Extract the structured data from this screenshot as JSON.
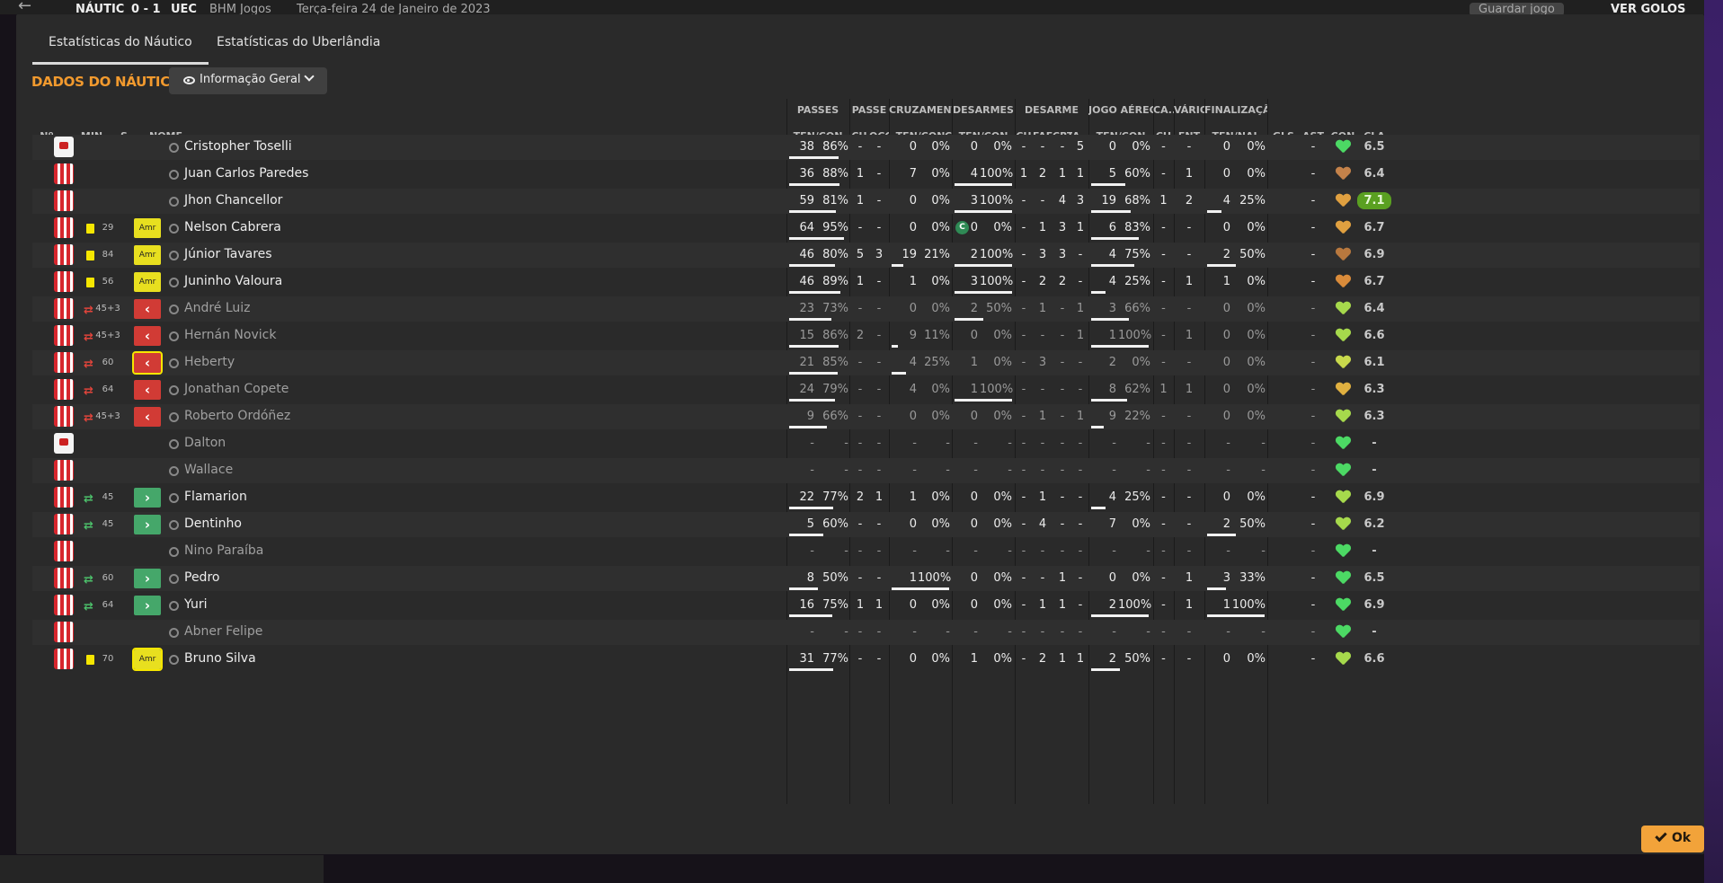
{
  "background": {
    "match_title": "NÁUTIC",
    "score": "0 - 1",
    "opponent": "UEC",
    "competition": "BHM Jogos",
    "date": "Terça-feira 24 de Janeiro de 2023",
    "save_label": "Guardar jogo",
    "goals_label": "VER GOLOS"
  },
  "tabs": [
    {
      "label": "Estatísticas do Náutico",
      "active": true
    },
    {
      "label": "Estatísticas do Uberlândia",
      "active": false
    }
  ],
  "team_title": "DADOS DO NÁUTICO",
  "view_selector": {
    "label": "Informação Geral"
  },
  "groups": [
    "PASSES",
    "PASSE",
    "CRUZAMENTOS",
    "DESARMES",
    "DESARME",
    "JOGO AÉREO",
    "CA...",
    "VÁRIOS",
    "FINALIZAÇÃO"
  ],
  "columns": {
    "num": "Nº",
    "min": "MIN",
    "s": "S",
    "name": "NOME",
    "c": "C",
    "passes": "TEN/CON",
    "passe_ch": "CH",
    "passe_ocg": "OCG",
    "cruz": "TEN/CON",
    "des": "TEN/CON",
    "desarme_ch": "CH",
    "desarme_faf": "FAF",
    "desarme_crt": "CRT",
    "desarme_a": "A...",
    "aereo": "TEN/CON",
    "ca_ch": "CH",
    "varios_fnt": "FNT",
    "fin": "TEN/NAL",
    "gls": "GLS",
    "ast": "AST",
    "con": "CON",
    "cla": "CLA"
  },
  "players": [
    {
      "name": "Cristopher Toselli",
      "gk": true,
      "card": false,
      "sub": "",
      "min": "",
      "badge": "",
      "captain": false,
      "dim": false,
      "passes": [
        "38",
        "86%"
      ],
      "passes_frac": 0.86,
      "passe": [
        "-",
        "-"
      ],
      "cruz": [
        "0",
        "0%"
      ],
      "cruz_frac": 0,
      "des": [
        "0",
        "0%"
      ],
      "des_frac": 0,
      "desarme": [
        "-",
        "-",
        "-",
        "5"
      ],
      "aereo": [
        "0",
        "0%"
      ],
      "aereo_frac": 0,
      "ca": "-",
      "fnt": "-",
      "fin": [
        "0",
        "0%"
      ],
      "fin_frac": 0,
      "ast": "-",
      "con_color": "#4cd964",
      "rating": "6.5",
      "best": false
    },
    {
      "name": "Juan Carlos Paredes",
      "gk": false,
      "card": false,
      "sub": "",
      "min": "",
      "badge": "",
      "captain": false,
      "dim": false,
      "passes": [
        "36",
        "88%"
      ],
      "passes_frac": 0.88,
      "passe": [
        "1",
        "-"
      ],
      "cruz": [
        "7",
        "0%"
      ],
      "cruz_frac": 0,
      "des": [
        "4",
        "100%"
      ],
      "des_frac": 1,
      "desarme": [
        "1",
        "2",
        "1",
        "1"
      ],
      "aereo": [
        "5",
        "60%"
      ],
      "aereo_frac": 0.6,
      "ca": "-",
      "fnt": "1",
      "fin": [
        "0",
        "0%"
      ],
      "fin_frac": 0,
      "ast": "-",
      "con_color": "#c4824a",
      "rating": "6.4",
      "best": false
    },
    {
      "name": "Jhon Chancellor",
      "gk": false,
      "card": false,
      "sub": "",
      "min": "",
      "badge": "",
      "captain": false,
      "dim": false,
      "passes": [
        "59",
        "81%"
      ],
      "passes_frac": 0.81,
      "passe": [
        "1",
        "-"
      ],
      "cruz": [
        "0",
        "0%"
      ],
      "cruz_frac": 0,
      "des": [
        "3",
        "100%"
      ],
      "des_frac": 1,
      "desarme": [
        "-",
        "-",
        "4",
        "3"
      ],
      "aereo": [
        "19",
        "68%"
      ],
      "aereo_frac": 0.68,
      "ca": "1",
      "fnt": "2",
      "fin": [
        "4",
        "25%"
      ],
      "fin_frac": 0.25,
      "ast": "-",
      "con_color": "#e0a040",
      "rating": "7.1",
      "best": true
    },
    {
      "name": "Nelson Cabrera",
      "gk": false,
      "card": true,
      "sub": "",
      "min": "29",
      "badge": "Amr",
      "captain": true,
      "dim": false,
      "passes": [
        "64",
        "95%"
      ],
      "passes_frac": 0.95,
      "passe": [
        "-",
        "-"
      ],
      "cruz": [
        "0",
        "0%"
      ],
      "cruz_frac": 0,
      "des": [
        "0",
        "0%"
      ],
      "des_frac": 0,
      "desarme": [
        "-",
        "1",
        "3",
        "1"
      ],
      "aereo": [
        "6",
        "83%"
      ],
      "aereo_frac": 0.83,
      "ca": "-",
      "fnt": "-",
      "fin": [
        "0",
        "0%"
      ],
      "fin_frac": 0,
      "ast": "-",
      "con_color": "#e0a040",
      "rating": "6.7",
      "best": false
    },
    {
      "name": "Júnior Tavares",
      "gk": false,
      "card": true,
      "sub": "",
      "min": "84",
      "badge": "Amr",
      "captain": false,
      "dim": false,
      "passes": [
        "46",
        "80%"
      ],
      "passes_frac": 0.8,
      "passe": [
        "5",
        "3"
      ],
      "cruz": [
        "19",
        "21%"
      ],
      "cruz_frac": 0.21,
      "des": [
        "2",
        "100%"
      ],
      "des_frac": 1,
      "desarme": [
        "-",
        "3",
        "3",
        "-"
      ],
      "aereo": [
        "4",
        "75%"
      ],
      "aereo_frac": 0.75,
      "ca": "-",
      "fnt": "-",
      "fin": [
        "2",
        "50%"
      ],
      "fin_frac": 0.5,
      "ast": "-",
      "con_color": "#b8783e",
      "rating": "6.9",
      "best": false
    },
    {
      "name": "Juninho Valoura",
      "gk": false,
      "card": true,
      "sub": "",
      "min": "56",
      "badge": "Amr",
      "captain": false,
      "dim": false,
      "passes": [
        "46",
        "89%"
      ],
      "passes_frac": 0.89,
      "passe": [
        "1",
        "-"
      ],
      "cruz": [
        "1",
        "0%"
      ],
      "cruz_frac": 0,
      "des": [
        "3",
        "100%"
      ],
      "des_frac": 1,
      "desarme": [
        "-",
        "2",
        "2",
        "-"
      ],
      "aereo": [
        "4",
        "25%"
      ],
      "aereo_frac": 0.25,
      "ca": "-",
      "fnt": "1",
      "fin": [
        "1",
        "0%"
      ],
      "fin_frac": 0,
      "ast": "-",
      "con_color": "#d98b3a",
      "rating": "6.7",
      "best": false
    },
    {
      "name": "André Luiz",
      "gk": false,
      "card": false,
      "sub": "out",
      "min": "45+3",
      "badge": "out",
      "captain": false,
      "dim": true,
      "passes": [
        "23",
        "73%"
      ],
      "passes_frac": 0.73,
      "passe": [
        "-",
        "-"
      ],
      "cruz": [
        "0",
        "0%"
      ],
      "cruz_frac": 0,
      "des": [
        "2",
        "50%"
      ],
      "des_frac": 0.5,
      "desarme": [
        "-",
        "1",
        "-",
        "1"
      ],
      "aereo": [
        "3",
        "66%"
      ],
      "aereo_frac": 0.66,
      "ca": "-",
      "fnt": "-",
      "fin": [
        "0",
        "0%"
      ],
      "fin_frac": 0,
      "ast": "-",
      "con_color": "#a6d94c",
      "rating": "6.4",
      "best": false
    },
    {
      "name": "Hernán Novick",
      "gk": false,
      "card": false,
      "sub": "out",
      "min": "45+3",
      "badge": "out",
      "captain": false,
      "dim": true,
      "passes": [
        "15",
        "86%"
      ],
      "passes_frac": 0.86,
      "passe": [
        "2",
        "-"
      ],
      "cruz": [
        "9",
        "11%"
      ],
      "cruz_frac": 0.11,
      "des": [
        "0",
        "0%"
      ],
      "des_frac": 0,
      "desarme": [
        "-",
        "-",
        "-",
        "1"
      ],
      "aereo": [
        "1",
        "100%"
      ],
      "aereo_frac": 1,
      "ca": "-",
      "fnt": "1",
      "fin": [
        "0",
        "0%"
      ],
      "fin_frac": 0,
      "ast": "-",
      "con_color": "#a6d94c",
      "rating": "6.6",
      "best": false
    },
    {
      "name": "Heberty",
      "gk": false,
      "card": false,
      "sub": "out",
      "min": "60",
      "badge": "out",
      "badge_sel": true,
      "captain": false,
      "dim": true,
      "passes": [
        "21",
        "85%"
      ],
      "passes_frac": 0.85,
      "passe": [
        "-",
        "-"
      ],
      "cruz": [
        "4",
        "25%"
      ],
      "cruz_frac": 0.25,
      "des": [
        "1",
        "0%"
      ],
      "des_frac": 0,
      "desarme": [
        "-",
        "3",
        "-",
        "-"
      ],
      "aereo": [
        "2",
        "0%"
      ],
      "aereo_frac": 0,
      "ca": "-",
      "fnt": "-",
      "fin": [
        "0",
        "0%"
      ],
      "fin_frac": 0,
      "ast": "-",
      "con_color": "#c8d94c",
      "rating": "6.1",
      "best": false
    },
    {
      "name": "Jonathan Copete",
      "gk": false,
      "card": false,
      "sub": "out",
      "min": "64",
      "badge": "out",
      "captain": false,
      "dim": true,
      "passes": [
        "24",
        "79%"
      ],
      "passes_frac": 0.79,
      "passe": [
        "-",
        "-"
      ],
      "cruz": [
        "4",
        "0%"
      ],
      "cruz_frac": 0,
      "des": [
        "1",
        "100%"
      ],
      "des_frac": 1,
      "desarme": [
        "-",
        "-",
        "-",
        "-"
      ],
      "aereo": [
        "8",
        "62%"
      ],
      "aereo_frac": 0.62,
      "ca": "1",
      "fnt": "1",
      "fin": [
        "0",
        "0%"
      ],
      "fin_frac": 0,
      "ast": "-",
      "con_color": "#e0b040",
      "rating": "6.3",
      "best": false
    },
    {
      "name": "Roberto Ordóñez",
      "gk": false,
      "card": false,
      "sub": "out",
      "min": "45+3",
      "badge": "out",
      "captain": false,
      "dim": true,
      "passes": [
        "9",
        "66%"
      ],
      "passes_frac": 0.66,
      "passe": [
        "-",
        "-"
      ],
      "cruz": [
        "0",
        "0%"
      ],
      "cruz_frac": 0,
      "des": [
        "0",
        "0%"
      ],
      "des_frac": 0,
      "desarme": [
        "-",
        "1",
        "-",
        "1"
      ],
      "aereo": [
        "9",
        "22%"
      ],
      "aereo_frac": 0.22,
      "ca": "-",
      "fnt": "-",
      "fin": [
        "0",
        "0%"
      ],
      "fin_frac": 0,
      "ast": "-",
      "con_color": "#a6d94c",
      "rating": "6.3",
      "best": false
    },
    {
      "name": "Dalton",
      "gk": true,
      "card": false,
      "sub": "",
      "min": "",
      "badge": "",
      "captain": false,
      "dim": true,
      "passes": [
        "-",
        "-"
      ],
      "passes_frac": 0,
      "passe": [
        "-",
        "-"
      ],
      "cruz": [
        "-",
        "-"
      ],
      "cruz_frac": 0,
      "des": [
        "-",
        "-"
      ],
      "des_frac": 0,
      "desarme": [
        "-",
        "-",
        "-",
        "-"
      ],
      "aereo": [
        "-",
        "-"
      ],
      "aereo_frac": 0,
      "ca": "-",
      "fnt": "-",
      "fin": [
        "-",
        "-"
      ],
      "fin_frac": 0,
      "ast": "-",
      "con_color": "#4cd964",
      "rating": "-",
      "best": false
    },
    {
      "name": "Wallace",
      "gk": false,
      "card": false,
      "sub": "",
      "min": "",
      "badge": "",
      "captain": false,
      "dim": true,
      "passes": [
        "-",
        "-"
      ],
      "passes_frac": 0,
      "passe": [
        "-",
        "-"
      ],
      "cruz": [
        "-",
        "-"
      ],
      "cruz_frac": 0,
      "des": [
        "-",
        "-"
      ],
      "des_frac": 0,
      "desarme": [
        "-",
        "-",
        "-",
        "-"
      ],
      "aereo": [
        "-",
        "-"
      ],
      "aereo_frac": 0,
      "ca": "-",
      "fnt": "-",
      "fin": [
        "-",
        "-"
      ],
      "fin_frac": 0,
      "ast": "-",
      "con_color": "#4cd964",
      "rating": "-",
      "best": false
    },
    {
      "name": "Flamarion",
      "gk": false,
      "card": false,
      "sub": "in",
      "min": "45",
      "badge": "in",
      "captain": false,
      "dim": false,
      "passes": [
        "22",
        "77%"
      ],
      "passes_frac": 0.77,
      "passe": [
        "2",
        "1"
      ],
      "cruz": [
        "1",
        "0%"
      ],
      "cruz_frac": 0,
      "des": [
        "0",
        "0%"
      ],
      "des_frac": 0,
      "desarme": [
        "-",
        "1",
        "-",
        "-"
      ],
      "aereo": [
        "4",
        "25%"
      ],
      "aereo_frac": 0.25,
      "ca": "-",
      "fnt": "-",
      "fin": [
        "0",
        "0%"
      ],
      "fin_frac": 0,
      "ast": "-",
      "con_color": "#a6d94c",
      "rating": "6.9",
      "best": false
    },
    {
      "name": "Dentinho",
      "gk": false,
      "card": false,
      "sub": "in",
      "min": "45",
      "badge": "in",
      "captain": false,
      "dim": false,
      "passes": [
        "5",
        "60%"
      ],
      "passes_frac": 0.6,
      "passe": [
        "-",
        "-"
      ],
      "cruz": [
        "0",
        "0%"
      ],
      "cruz_frac": 0,
      "des": [
        "0",
        "0%"
      ],
      "des_frac": 0,
      "desarme": [
        "-",
        "4",
        "-",
        "-"
      ],
      "aereo": [
        "7",
        "0%"
      ],
      "aereo_frac": 0,
      "ca": "-",
      "fnt": "-",
      "fin": [
        "2",
        "50%"
      ],
      "fin_frac": 0.5,
      "ast": "-",
      "con_color": "#a6d94c",
      "rating": "6.2",
      "best": false
    },
    {
      "name": "Nino Paraíba",
      "gk": false,
      "card": false,
      "sub": "",
      "min": "",
      "badge": "",
      "captain": false,
      "dim": true,
      "passes": [
        "-",
        "-"
      ],
      "passes_frac": 0,
      "passe": [
        "-",
        "-"
      ],
      "cruz": [
        "-",
        "-"
      ],
      "cruz_frac": 0,
      "des": [
        "-",
        "-"
      ],
      "des_frac": 0,
      "desarme": [
        "-",
        "-",
        "-",
        "-"
      ],
      "aereo": [
        "-",
        "-"
      ],
      "aereo_frac": 0,
      "ca": "-",
      "fnt": "-",
      "fin": [
        "-",
        "-"
      ],
      "fin_frac": 0,
      "ast": "-",
      "con_color": "#4cd964",
      "rating": "-",
      "best": false
    },
    {
      "name": "Pedro",
      "gk": false,
      "card": false,
      "sub": "in",
      "min": "60",
      "badge": "in",
      "captain": false,
      "dim": false,
      "passes": [
        "8",
        "50%"
      ],
      "passes_frac": 0.5,
      "passe": [
        "-",
        "-"
      ],
      "cruz": [
        "1",
        "100%"
      ],
      "cruz_frac": 1,
      "des": [
        "0",
        "0%"
      ],
      "des_frac": 0,
      "desarme": [
        "-",
        "-",
        "1",
        "-"
      ],
      "aereo": [
        "0",
        "0%"
      ],
      "aereo_frac": 0,
      "ca": "-",
      "fnt": "1",
      "fin": [
        "3",
        "33%"
      ],
      "fin_frac": 0.33,
      "ast": "-",
      "con_color": "#4cd964",
      "rating": "6.5",
      "best": false
    },
    {
      "name": "Yuri",
      "gk": false,
      "card": false,
      "sub": "in",
      "min": "64",
      "badge": "in",
      "captain": false,
      "dim": false,
      "passes": [
        "16",
        "75%"
      ],
      "passes_frac": 0.75,
      "passe": [
        "1",
        "1"
      ],
      "cruz": [
        "0",
        "0%"
      ],
      "cruz_frac": 0,
      "des": [
        "0",
        "0%"
      ],
      "des_frac": 0,
      "desarme": [
        "-",
        "1",
        "1",
        "-"
      ],
      "aereo": [
        "2",
        "100%"
      ],
      "aereo_frac": 1,
      "ca": "-",
      "fnt": "1",
      "fin": [
        "1",
        "100%"
      ],
      "fin_frac": 1,
      "ast": "-",
      "con_color": "#4cd964",
      "rating": "6.9",
      "best": false
    },
    {
      "name": "Abner Felipe",
      "gk": false,
      "card": false,
      "sub": "",
      "min": "",
      "badge": "",
      "captain": false,
      "dim": true,
      "passes": [
        "-",
        "-"
      ],
      "passes_frac": 0,
      "passe": [
        "-",
        "-"
      ],
      "cruz": [
        "-",
        "-"
      ],
      "cruz_frac": 0,
      "des": [
        "-",
        "-"
      ],
      "des_frac": 0,
      "desarme": [
        "-",
        "-",
        "-",
        "-"
      ],
      "aereo": [
        "-",
        "-"
      ],
      "aereo_frac": 0,
      "ca": "-",
      "fnt": "-",
      "fin": [
        "-",
        "-"
      ],
      "fin_frac": 0,
      "ast": "-",
      "con_color": "#4cd964",
      "rating": "-",
      "best": false
    },
    {
      "name": "Bruno Silva",
      "gk": false,
      "card": true,
      "sub": "",
      "min": "70",
      "badge": "Amr",
      "badge_sel": true,
      "captain": false,
      "dim": false,
      "passes": [
        "31",
        "77%"
      ],
      "passes_frac": 0.77,
      "passe": [
        "-",
        "-"
      ],
      "cruz": [
        "0",
        "0%"
      ],
      "cruz_frac": 0,
      "des": [
        "1",
        "0%"
      ],
      "des_frac": 0,
      "desarme": [
        "-",
        "2",
        "1",
        "1"
      ],
      "aereo": [
        "2",
        "50%"
      ],
      "aereo_frac": 0.5,
      "ca": "-",
      "fnt": "-",
      "fin": [
        "0",
        "0%"
      ],
      "fin_frac": 0,
      "ast": "-",
      "con_color": "#a6d94c",
      "rating": "6.6",
      "best": false
    }
  ],
  "captain_glyph": "C",
  "ok_label": "Ok"
}
